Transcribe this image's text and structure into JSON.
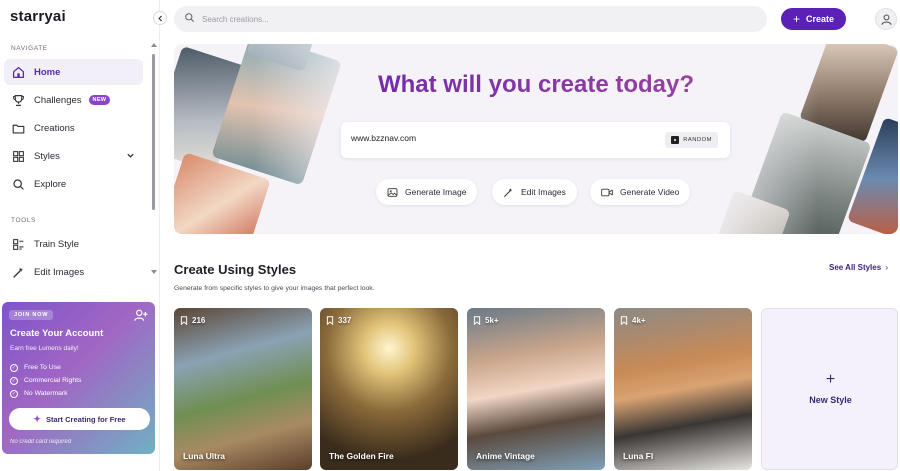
{
  "app": {
    "logo": "starryai"
  },
  "sidebar": {
    "navigate_label": "NAVIGATE",
    "tools_label": "TOOLS",
    "nav": [
      {
        "label": "Home",
        "icon": "home-icon",
        "active": true
      },
      {
        "label": "Challenges",
        "icon": "trophy-icon",
        "badge": "NEW"
      },
      {
        "label": "Creations",
        "icon": "folder-icon"
      },
      {
        "label": "Styles",
        "icon": "styles-icon",
        "has_chevron": true
      },
      {
        "label": "Explore",
        "icon": "search-icon"
      }
    ],
    "tools": [
      {
        "label": "Train Style",
        "icon": "train-icon"
      },
      {
        "label": "Edit Images",
        "icon": "wand-icon"
      }
    ]
  },
  "promo": {
    "tag": "JOIN NOW",
    "title": "Create Your Account",
    "subtitle": "Earn free Lumens daily!",
    "perks": [
      "Free To Use",
      "Commercial Rights",
      "No Watermark"
    ],
    "cta": "Start Creating for Free",
    "note": "No credit card required"
  },
  "topbar": {
    "search_placeholder": "Search creations...",
    "create_label": "Create"
  },
  "hero": {
    "title": "What will you create today?",
    "prompt_value": "www.bzznav.com",
    "random_label": "RANDOM",
    "actions": [
      {
        "label": "Generate Image",
        "icon": "image-icon"
      },
      {
        "label": "Edit Images",
        "icon": "wand-icon"
      },
      {
        "label": "Generate Video",
        "icon": "video-icon"
      }
    ]
  },
  "styles_section": {
    "title": "Create Using Styles",
    "subtitle": "Generate from specific styles to give your images that perfect look.",
    "see_all": "See All Styles",
    "cards": [
      {
        "name": "Luna Ultra",
        "count": "216"
      },
      {
        "name": "The Golden Fire",
        "count": "337"
      },
      {
        "name": "Anime Vintage",
        "count": "5k+"
      },
      {
        "name": "Luna Fl",
        "count": "4k+"
      }
    ],
    "new_style_label": "New Style"
  },
  "colors": {
    "accent": "#5b21b6",
    "active_bg": "#f3eff9",
    "badge": "#8e44c9"
  }
}
